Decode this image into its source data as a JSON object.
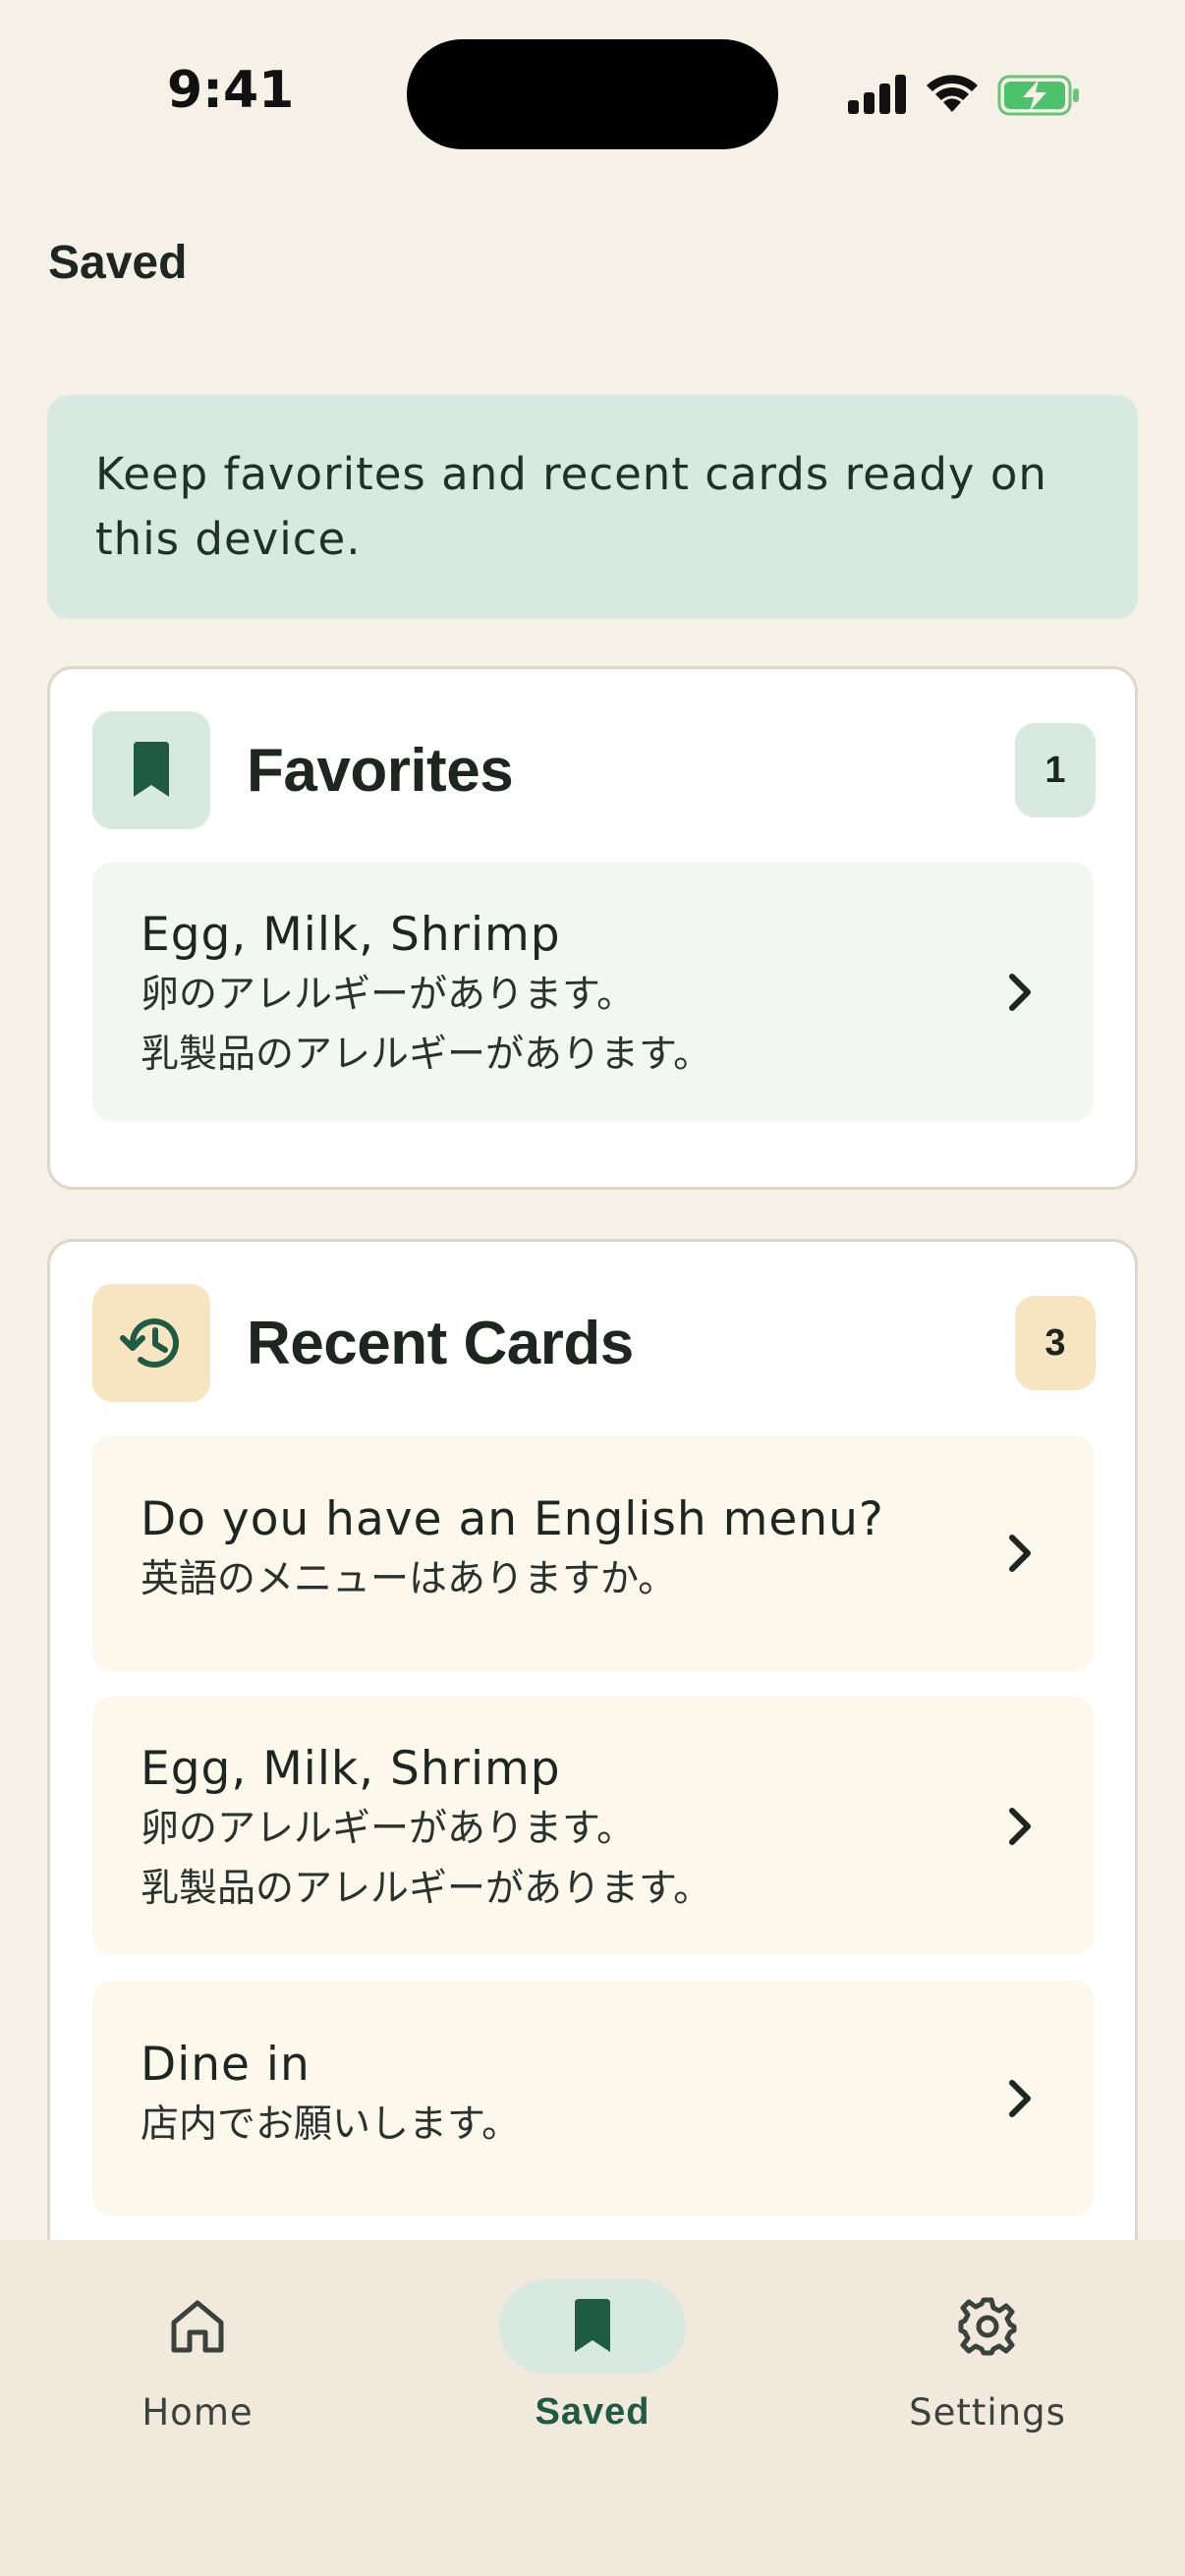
{
  "status_bar": {
    "time": "9:41"
  },
  "header": {
    "title": "Saved"
  },
  "banner": {
    "text": "Keep favorites and recent cards ready on this device."
  },
  "favorites": {
    "title": "Favorites",
    "count": "1",
    "icon": "bookmark-icon",
    "items": [
      {
        "title": "Egg, Milk, Shrimp",
        "lines": [
          "卵のアレルギーがあります。",
          "乳製品のアレルギーがあります。"
        ]
      }
    ]
  },
  "recent": {
    "title": "Recent Cards",
    "count": "3",
    "icon": "history-icon",
    "items": [
      {
        "title": "Do you have an English menu?",
        "lines": [
          "英語のメニューはありますか。"
        ]
      },
      {
        "title": "Egg, Milk, Shrimp",
        "lines": [
          "卵のアレルギーがあります。",
          "乳製品のアレルギーがあります。"
        ]
      },
      {
        "title": "Dine in",
        "lines": [
          "店内でお願いします。"
        ]
      }
    ]
  },
  "tab_bar": {
    "tabs": [
      {
        "label": "Home",
        "icon": "home-icon"
      },
      {
        "label": "Saved",
        "icon": "bookmark-icon",
        "selected": true
      },
      {
        "label": "Settings",
        "icon": "gear-icon"
      }
    ]
  },
  "colors": {
    "background": "#F5F1E6",
    "accent_green": "#1F5A44",
    "mint": "#D8E9E1",
    "amber": "#F6E5C0"
  }
}
